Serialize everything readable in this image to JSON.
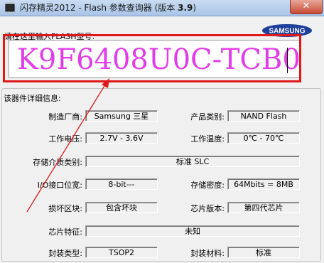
{
  "window": {
    "title_prefix": "闪存精灵2012 - Flash 参数查询器 (版本",
    "title_version": "3.9",
    "title_suffix": ")",
    "close_label": "✕"
  },
  "input": {
    "prompt": "请在这里输入FLASH型号:",
    "value": "K9F6408U0C-TCB0"
  },
  "logo": {
    "text": "SAMSUNG"
  },
  "details": {
    "group_title": "该器件详细信息:",
    "manufacturer": {
      "label": "制造厂商:",
      "value": "Samsung 三星"
    },
    "product_type": {
      "label": "产品类别:",
      "value": "NAND Flash"
    },
    "voltage": {
      "label": "工作电压:",
      "value": "2.7V - 3.6V"
    },
    "temperature": {
      "label": "工作温度:",
      "value": "0℃ - 70℃"
    },
    "media_type": {
      "label": "存储介质类别:",
      "value": "标准 SLC"
    },
    "io_width": {
      "label": "I/O接口位宽:",
      "value": "8-bit---"
    },
    "density": {
      "label": "存储密度:",
      "value": "64Mbits = 8MB"
    },
    "bad_block": {
      "label": "损坏区块:",
      "value": "包含坏块"
    },
    "chip_version": {
      "label": "芯片版本:",
      "value": "第四代芯片"
    },
    "chip_feature": {
      "label": "芯片特征:",
      "value": "未知"
    },
    "package_type": {
      "label": "封装类型:",
      "value": "TSOP2"
    },
    "package_material": {
      "label": "封装材料:",
      "value": "标准"
    }
  },
  "colors": {
    "input_text": "#e23ce8",
    "annotation_red": "#e01818",
    "samsung_blue": "#1e3f9a"
  }
}
